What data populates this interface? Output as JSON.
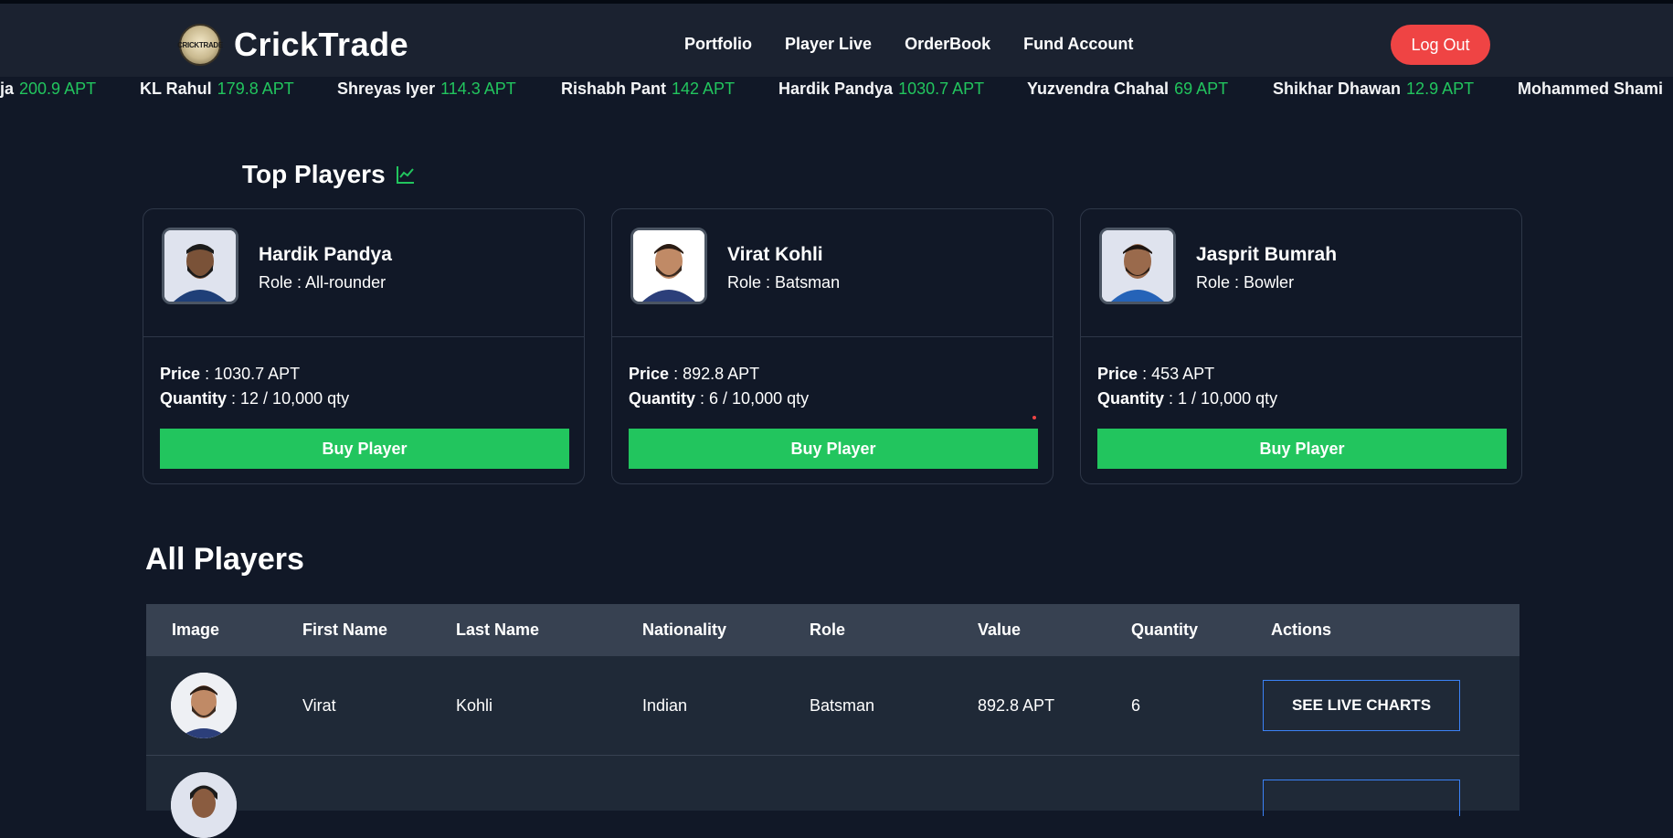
{
  "brand": {
    "logo_text": "CRICKTRADE",
    "name": "CrickTrade"
  },
  "nav": {
    "items": [
      "Portfolio",
      "Player Live",
      "OrderBook",
      "Fund Account"
    ],
    "logout": "Log Out"
  },
  "ticker": [
    {
      "name": "ja",
      "price": "200.9 APT"
    },
    {
      "name": "KL Rahul",
      "price": "179.8 APT"
    },
    {
      "name": "Shreyas Iyer",
      "price": "114.3 APT"
    },
    {
      "name": "Rishabh Pant",
      "price": "142 APT"
    },
    {
      "name": "Hardik Pandya",
      "price": "1030.7 APT"
    },
    {
      "name": "Yuzvendra Chahal",
      "price": "69 APT"
    },
    {
      "name": "Shikhar Dhawan",
      "price": "12.9 APT"
    },
    {
      "name": "Mohammed Shami",
      "price": ""
    }
  ],
  "top_players": {
    "title": "Top Players",
    "cards": [
      {
        "name": "Hardik Pandya",
        "role_label": "Role :",
        "role": "All-rounder",
        "price_label": "Price",
        "price": ": 1030.7 APT",
        "qty_label": "Quantity",
        "qty": ": 12 / 10,000 qty",
        "button": "Buy Player"
      },
      {
        "name": "Virat Kohli",
        "role_label": "Role :",
        "role": "Batsman",
        "price_label": "Price",
        "price": ": 892.8 APT",
        "qty_label": "Quantity",
        "qty": ": 6 / 10,000 qty",
        "button": "Buy Player"
      },
      {
        "name": "Jasprit Bumrah",
        "role_label": "Role :",
        "role": "Bowler",
        "price_label": "Price",
        "price": ": 453 APT",
        "qty_label": "Quantity",
        "qty": ": 1 / 10,000 qty",
        "button": "Buy Player"
      }
    ]
  },
  "all_players": {
    "title": "All Players",
    "columns": [
      "Image",
      "First Name",
      "Last Name",
      "Nationality",
      "Role",
      "Value",
      "Quantity",
      "Actions"
    ],
    "rows": [
      {
        "first": "Virat",
        "last": "Kohli",
        "nationality": "Indian",
        "role": "Batsman",
        "value": "892.8 APT",
        "quantity": "6",
        "action": "SEE LIVE CHARTS"
      }
    ]
  },
  "colors": {
    "background": "#111827",
    "accent_green": "#22c55e",
    "logout_red": "#ef4444",
    "button_border": "#3b82f6"
  }
}
